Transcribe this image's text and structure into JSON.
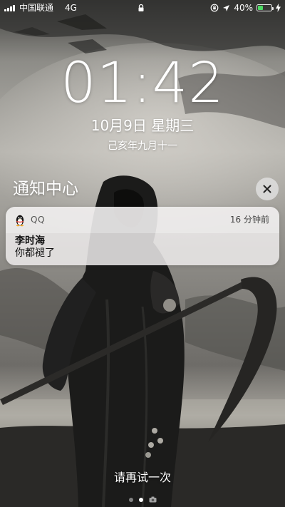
{
  "status_bar": {
    "carrier": "中国联通",
    "network": "4G",
    "battery_percent": "40%",
    "battery_level": 0.4,
    "battery_color": "#4cd964",
    "icons": [
      "signal-icon",
      "lock-icon",
      "orientation-lock-icon",
      "location-icon",
      "battery-icon",
      "charging-bolt-icon"
    ]
  },
  "lock_screen": {
    "time": "01:42",
    "date": "10月9日 星期三",
    "lunar_date": "己亥年九月十一"
  },
  "notification_center": {
    "title": "通知中心",
    "close_icon": "close-icon"
  },
  "notification": {
    "app_icon": "qq-penguin-icon",
    "app_name": "QQ",
    "time": "16 分钟前",
    "sender": "李时海",
    "message": "你都褪了"
  },
  "footer": {
    "retry_text": "请再试一次",
    "page_dots": 3,
    "active_page": 1,
    "camera_icon": "camera-icon"
  }
}
